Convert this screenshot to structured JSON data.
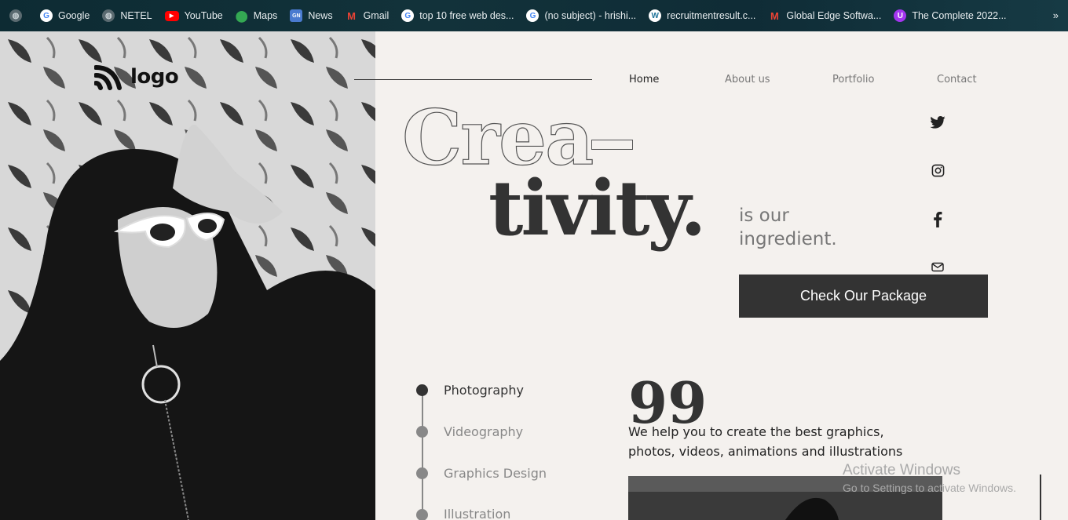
{
  "bookmarks": [
    {
      "label": "",
      "icon": "globe-icon"
    },
    {
      "label": "Google",
      "icon": "google-icon"
    },
    {
      "label": "NETEL",
      "icon": "globe-icon"
    },
    {
      "label": "YouTube",
      "icon": "youtube-icon"
    },
    {
      "label": "Maps",
      "icon": "maps-icon"
    },
    {
      "label": "News",
      "icon": "news-icon"
    },
    {
      "label": "Gmail",
      "icon": "gmail-icon"
    },
    {
      "label": "top 10 free web des...",
      "icon": "google-icon"
    },
    {
      "label": "(no subject) - hrishi...",
      "icon": "google-icon"
    },
    {
      "label": "recruitmentresult.c...",
      "icon": "wordpress-icon"
    },
    {
      "label": "Global Edge Softwa...",
      "icon": "gmail-icon"
    },
    {
      "label": "The Complete 2022...",
      "icon": "udemy-icon"
    }
  ],
  "bookmarks_more": "»",
  "logo": {
    "text": "logo"
  },
  "nav": {
    "home": "Home",
    "about": "About us",
    "portfolio": "Portfolio",
    "contact": "Contact"
  },
  "hero": {
    "line1": "Crea",
    "line2": "tivity.",
    "tagline_1": "is our",
    "tagline_2": "ingredient.",
    "cta": "Check Our Package"
  },
  "social": [
    "twitter-icon",
    "instagram-icon",
    "facebook-icon",
    "mail-icon"
  ],
  "services": [
    "Photography",
    "Videography",
    "Graphics Design",
    "Illustration"
  ],
  "quote": {
    "mark": "99",
    "text": "We help you to create the best graphics, photos, videos, animations and illustrations"
  },
  "watermark": {
    "title": "Activate Windows",
    "subtitle": "Go to Settings to activate Windows."
  },
  "colors": {
    "dark": "#333333",
    "bg": "#f4f1ee",
    "muted": "#888888"
  }
}
